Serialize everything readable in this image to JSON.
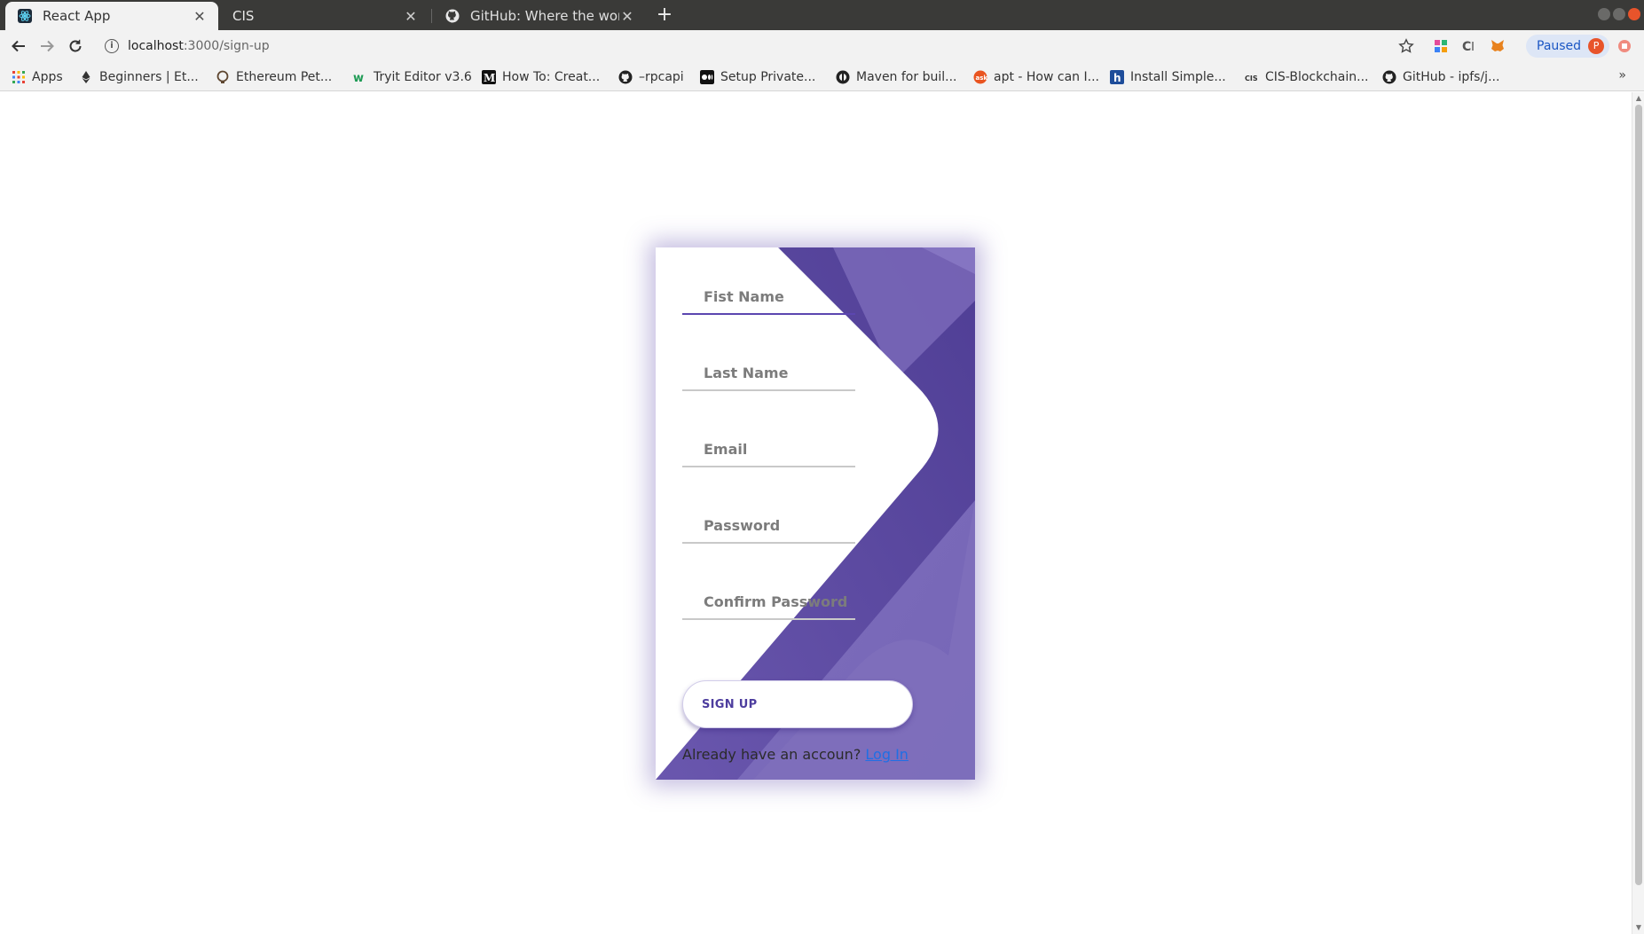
{
  "browser": {
    "tabs": [
      {
        "title": "React App",
        "active": true
      },
      {
        "title": "CIS",
        "active": false
      },
      {
        "title": "GitHub: Where the world",
        "active": false
      }
    ],
    "url_host": "localhost",
    "url_path": ":3000/sign-up",
    "profile_status": "Paused",
    "profile_initial": "P",
    "bookmarks": [
      {
        "label": "Apps",
        "icon": "apps-grid-icon"
      },
      {
        "label": "Beginners | Et...",
        "icon": "ethereum-icon"
      },
      {
        "label": "Ethereum Pet...",
        "icon": "truffle-icon"
      },
      {
        "label": "Tryit Editor v3.6",
        "icon": "w3schools-icon"
      },
      {
        "label": "How To: Creat...",
        "icon": "medium-icon"
      },
      {
        "label": "–rpcapi",
        "icon": "github-icon"
      },
      {
        "label": "Setup Private...",
        "icon": "medium-icon"
      },
      {
        "label": "Maven for buil...",
        "icon": "maven-icon"
      },
      {
        "label": "apt - How can I...",
        "icon": "askubuntu-icon"
      },
      {
        "label": "Install Simple...",
        "icon": "hashnode-icon"
      },
      {
        "label": "CIS-Blockchain...",
        "icon": "cis-icon"
      },
      {
        "label": "GitHub - ipfs/j...",
        "icon": "github-icon"
      }
    ],
    "more_bookmarks": "»"
  },
  "signup_form": {
    "fields": [
      {
        "name": "first-name-field",
        "placeholder": "Fist Name",
        "value": ""
      },
      {
        "name": "last-name-field",
        "placeholder": "Last Name",
        "value": ""
      },
      {
        "name": "email-field",
        "placeholder": "Email",
        "value": ""
      },
      {
        "name": "password-field",
        "placeholder": "Password",
        "value": ""
      },
      {
        "name": "confirm-password-field",
        "placeholder": "Confirm Password",
        "value": ""
      }
    ],
    "submit_label": "SIGN UP",
    "login_prompt": "Already have an accoun?",
    "login_link": "Log In"
  },
  "colors": {
    "accent": "#5b46b0",
    "card_purple_light": "#7a6bb9",
    "card_purple_dark": "#564399",
    "link": "#1f6fe5"
  }
}
